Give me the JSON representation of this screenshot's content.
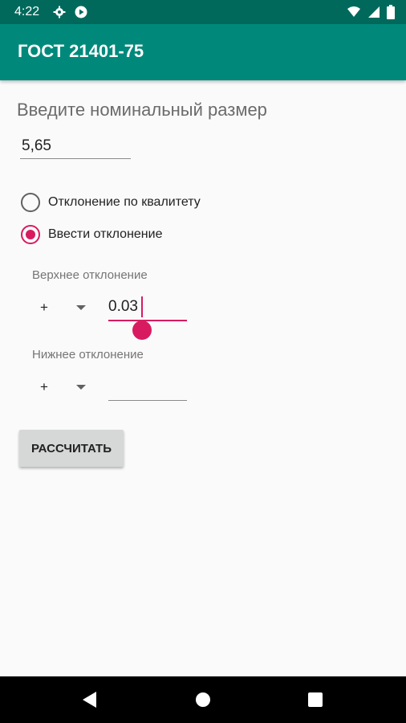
{
  "status_bar": {
    "time": "4:22",
    "icons": [
      "gear-icon",
      "play-icon",
      "wifi-icon",
      "signal-icon",
      "battery-icon"
    ]
  },
  "toolbar": {
    "title": "ГОСТ 21401-75"
  },
  "form": {
    "nominal_label": "Введите номинальный размер",
    "nominal_value": "5,65",
    "radio_options": [
      {
        "label": "Отклонение по квалитету",
        "checked": false
      },
      {
        "label": "Ввести отклонение",
        "checked": true
      }
    ],
    "upper": {
      "label": "Верхнее отклонение",
      "sign": "+",
      "value": "0.03"
    },
    "lower": {
      "label": "Нижнее отклонение",
      "sign": "+",
      "value": ""
    },
    "calculate_label": "РАССЧИТАТЬ"
  },
  "colors": {
    "status_bar": "#00695c",
    "toolbar": "#00897b",
    "accent": "#d81b60",
    "background": "#fafafa",
    "button": "#d6d7d7"
  }
}
